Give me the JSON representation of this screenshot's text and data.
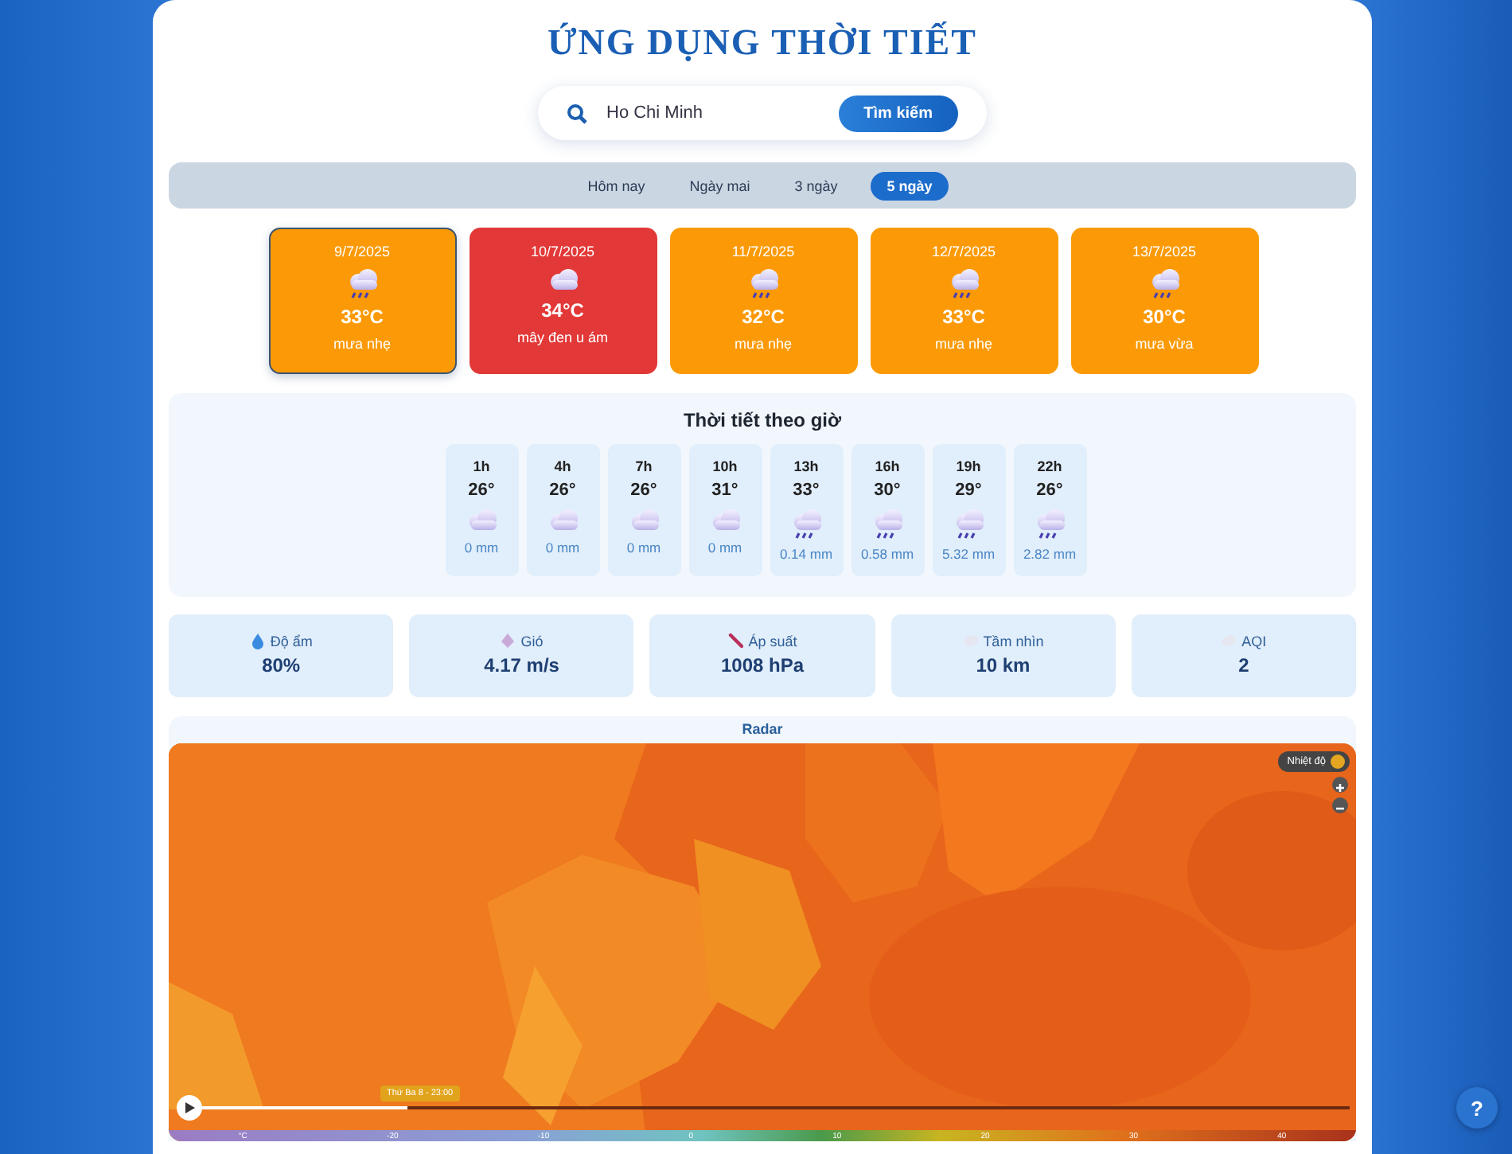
{
  "title": "ỨNG DỤNG THỜI TIẾT",
  "search": {
    "value": "Ho Chi Minh",
    "button": "Tìm kiếm"
  },
  "tabs": [
    {
      "label": "Hôm nay",
      "selected": false
    },
    {
      "label": "Ngày mai",
      "selected": false
    },
    {
      "label": "3 ngày",
      "selected": false
    },
    {
      "label": "5 ngày",
      "selected": true
    }
  ],
  "days": [
    {
      "date": "9/7/2025",
      "kind": "rain",
      "temp": "33°C",
      "desc": "mưa nhẹ",
      "color": "#fb9a06",
      "selected": true
    },
    {
      "date": "10/7/2025",
      "kind": "cloud",
      "temp": "34°C",
      "desc": "mây đen u ám",
      "color": "#e23838",
      "selected": false
    },
    {
      "date": "11/7/2025",
      "kind": "rain",
      "temp": "32°C",
      "desc": "mưa nhẹ",
      "color": "#fb9a06",
      "selected": false
    },
    {
      "date": "12/7/2025",
      "kind": "rain",
      "temp": "33°C",
      "desc": "mưa nhẹ",
      "color": "#fb9a06",
      "selected": false
    },
    {
      "date": "13/7/2025",
      "kind": "rain",
      "temp": "30°C",
      "desc": "mưa vừa",
      "color": "#fb9a06",
      "selected": false
    }
  ],
  "hourly": {
    "title": "Thời tiết theo giờ",
    "hours": [
      {
        "time": "1h",
        "temp": "26°",
        "kind": "cloud",
        "rain": "0 mm"
      },
      {
        "time": "4h",
        "temp": "26°",
        "kind": "cloud",
        "rain": "0 mm"
      },
      {
        "time": "7h",
        "temp": "26°",
        "kind": "cloud",
        "rain": "0 mm"
      },
      {
        "time": "10h",
        "temp": "31°",
        "kind": "cloud",
        "rain": "0 mm"
      },
      {
        "time": "13h",
        "temp": "33°",
        "kind": "rain",
        "rain": "0.14 mm"
      },
      {
        "time": "16h",
        "temp": "30°",
        "kind": "rain",
        "rain": "0.58 mm"
      },
      {
        "time": "19h",
        "temp": "29°",
        "kind": "rain",
        "rain": "5.32 mm"
      },
      {
        "time": "22h",
        "temp": "26°",
        "kind": "rain",
        "rain": "2.82 mm"
      }
    ]
  },
  "stats": [
    {
      "kind": "humidity",
      "label": "Độ ẩm",
      "value": "80%"
    },
    {
      "kind": "wind",
      "label": "Gió",
      "value": "4.17 m/s"
    },
    {
      "kind": "pressure",
      "label": "Áp suất",
      "value": "1008 hPa"
    },
    {
      "kind": "visibility",
      "label": "Tầm nhìn",
      "value": "10 km"
    },
    {
      "kind": "aqi",
      "label": "AQI",
      "value": "2"
    }
  ],
  "radar": {
    "title": "Radar",
    "layer": "Nhiệt độ",
    "time": "Thứ Ba 8 - 23:00",
    "scale": [
      "°C",
      "-20",
      "-10",
      "0",
      "10",
      "20",
      "30",
      "40"
    ]
  },
  "help": "?"
}
